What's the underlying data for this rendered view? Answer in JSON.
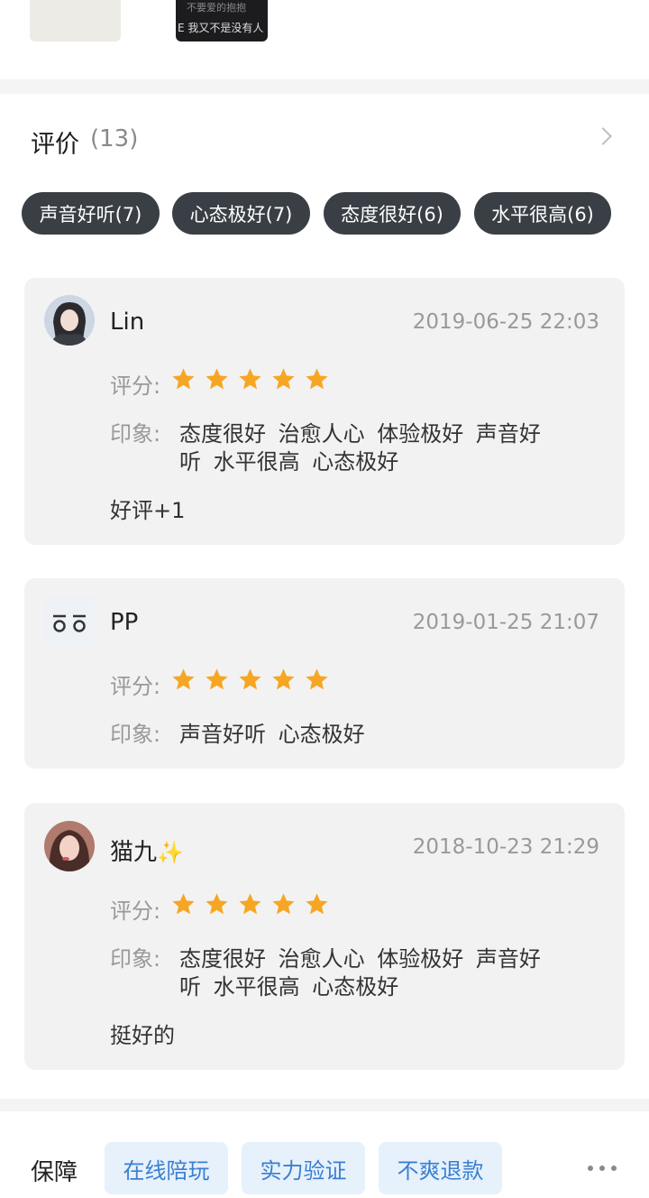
{
  "top_section": {
    "dark_thumb_line1": "不要爱的抱抱",
    "dark_thumb_line2": "E 我又不是没有人"
  },
  "reviews": {
    "title": "评价",
    "count": "(13)",
    "tags": [
      {
        "label": "声音好听(7)"
      },
      {
        "label": "心态极好(7)"
      },
      {
        "label": "态度很好(6)"
      },
      {
        "label": "水平很高(6)"
      }
    ],
    "score_label": "评分:",
    "impression_label": "印象:",
    "items": [
      {
        "username": "Lin",
        "date": "2019-06-25 22:03",
        "rating": 5,
        "impression_line1": "态度很好 治愈人心 体验极好 声音好",
        "impression_line2": "听 水平很高 心态极好",
        "comment": "好评+1"
      },
      {
        "username": "PP",
        "date": "2019-01-25 21:07",
        "rating": 5,
        "impression_line1": "声音好听 心态极好"
      },
      {
        "username": "猫九",
        "username_suffix": "✨",
        "date": "2018-10-23 21:29",
        "rating": 5,
        "impression_line1": "态度很好 治愈人心 体验极好 声音好",
        "impression_line2": "听 水平很高 心态极好",
        "comment": "挺好的"
      }
    ]
  },
  "guarantee": {
    "label": "保障",
    "chips": [
      {
        "label": "在线陪玩"
      },
      {
        "label": "实力验证"
      },
      {
        "label": "不爽退款"
      }
    ]
  },
  "colors": {
    "star": "#f6a623",
    "chip_dark": "#3a3f45",
    "guarantee_chip_bg": "#e6f1fc",
    "guarantee_chip_text": "#3b7fd0"
  },
  "icons": {
    "star": "star-icon",
    "chevron": "chevron-right-icon",
    "more": "more-dots-icon",
    "sparkle": "sparkles-icon"
  }
}
